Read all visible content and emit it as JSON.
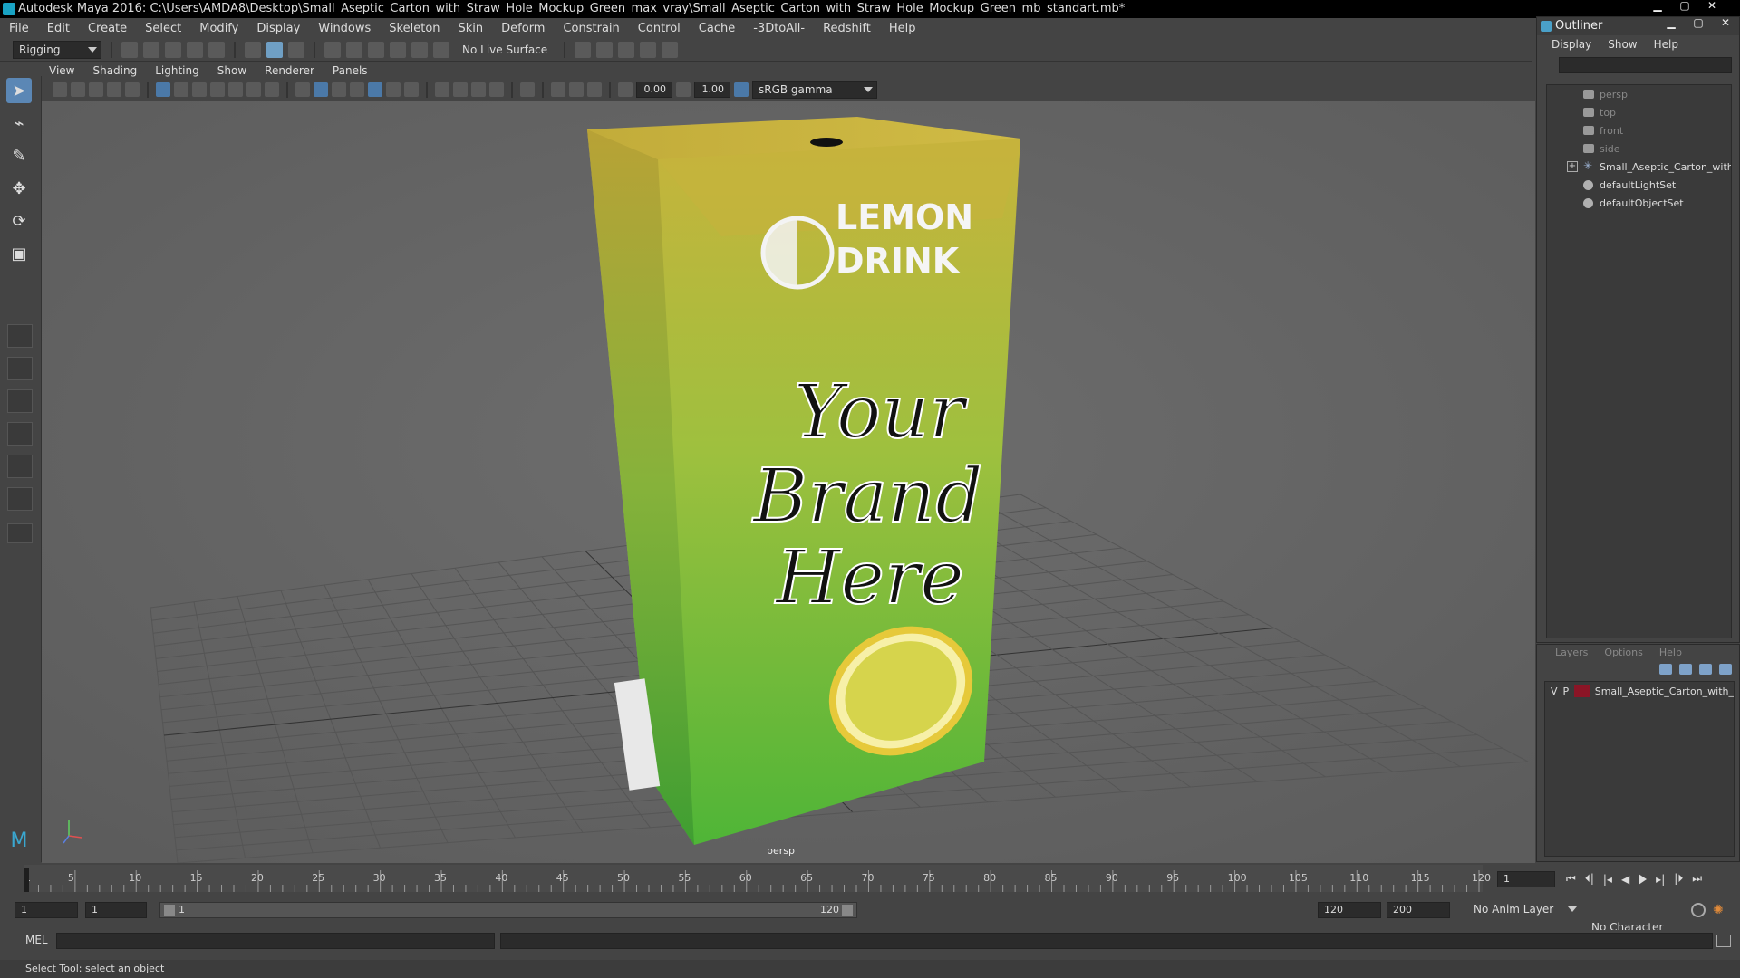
{
  "window": {
    "title": "Autodesk Maya 2016: C:\\Users\\AMDA8\\Desktop\\Small_Aseptic_Carton_with_Straw_Hole_Mockup_Green_max_vray\\Small_Aseptic_Carton_with_Straw_Hole_Mockup_Green_mb_standart.mb*"
  },
  "menubar": [
    "File",
    "Edit",
    "Create",
    "Select",
    "Modify",
    "Display",
    "Windows",
    "Skeleton",
    "Skin",
    "Deform",
    "Constrain",
    "Control",
    "Cache",
    "-3DtoAll-",
    "Redshift",
    "Help"
  ],
  "toolbar": {
    "mode": "Rigging",
    "live_surface": "No Live Surface"
  },
  "panel_menu": [
    "View",
    "Shading",
    "Lighting",
    "Show",
    "Renderer",
    "Panels"
  ],
  "view_toolbar": {
    "exposure": "0.00",
    "gamma": "1.00",
    "color_space": "sRGB gamma"
  },
  "viewport": {
    "camera": "persp",
    "model": {
      "brand_line1": "LEMON",
      "brand_line2": "DRINK",
      "script_line1": "Your",
      "script_line2": "Brand",
      "script_line3": "Here"
    }
  },
  "outliner": {
    "title": "Outliner",
    "menu": [
      "Display",
      "Show",
      "Help"
    ],
    "items": [
      {
        "label": "persp",
        "dim": true
      },
      {
        "label": "top",
        "dim": true
      },
      {
        "label": "front",
        "dim": true
      },
      {
        "label": "side",
        "dim": true
      },
      {
        "label": "Small_Aseptic_Carton_with",
        "dim": false
      },
      {
        "label": "defaultLightSet",
        "dim": false
      },
      {
        "label": "defaultObjectSet",
        "dim": false
      }
    ]
  },
  "layers": {
    "header": [
      "Layers",
      "Options",
      "Help"
    ],
    "items": [
      {
        "visible": "V",
        "playback": "P",
        "name": "Small_Aseptic_Carton_with_",
        "color": "#8b1526"
      }
    ]
  },
  "timeline": {
    "ticks": [
      1,
      5,
      10,
      15,
      20,
      25,
      30,
      35,
      40,
      45,
      50,
      55,
      60,
      65,
      70,
      75,
      80,
      85,
      90,
      95,
      100,
      105,
      110,
      115,
      120
    ],
    "current_frame": "1"
  },
  "range": {
    "start": "1",
    "playback_start": "1",
    "slider_start": "1",
    "slider_end": "120",
    "playback_end": "120",
    "end": "200",
    "anim_layer": "No Anim Layer",
    "character_set": "No Character Set"
  },
  "command": {
    "label": "MEL"
  },
  "status": {
    "help": "Select Tool: select an object"
  },
  "colors": {
    "carton_yellow": "#c9b43a",
    "carton_green": "#5ab838",
    "accent_blue": "#5b87b5"
  }
}
